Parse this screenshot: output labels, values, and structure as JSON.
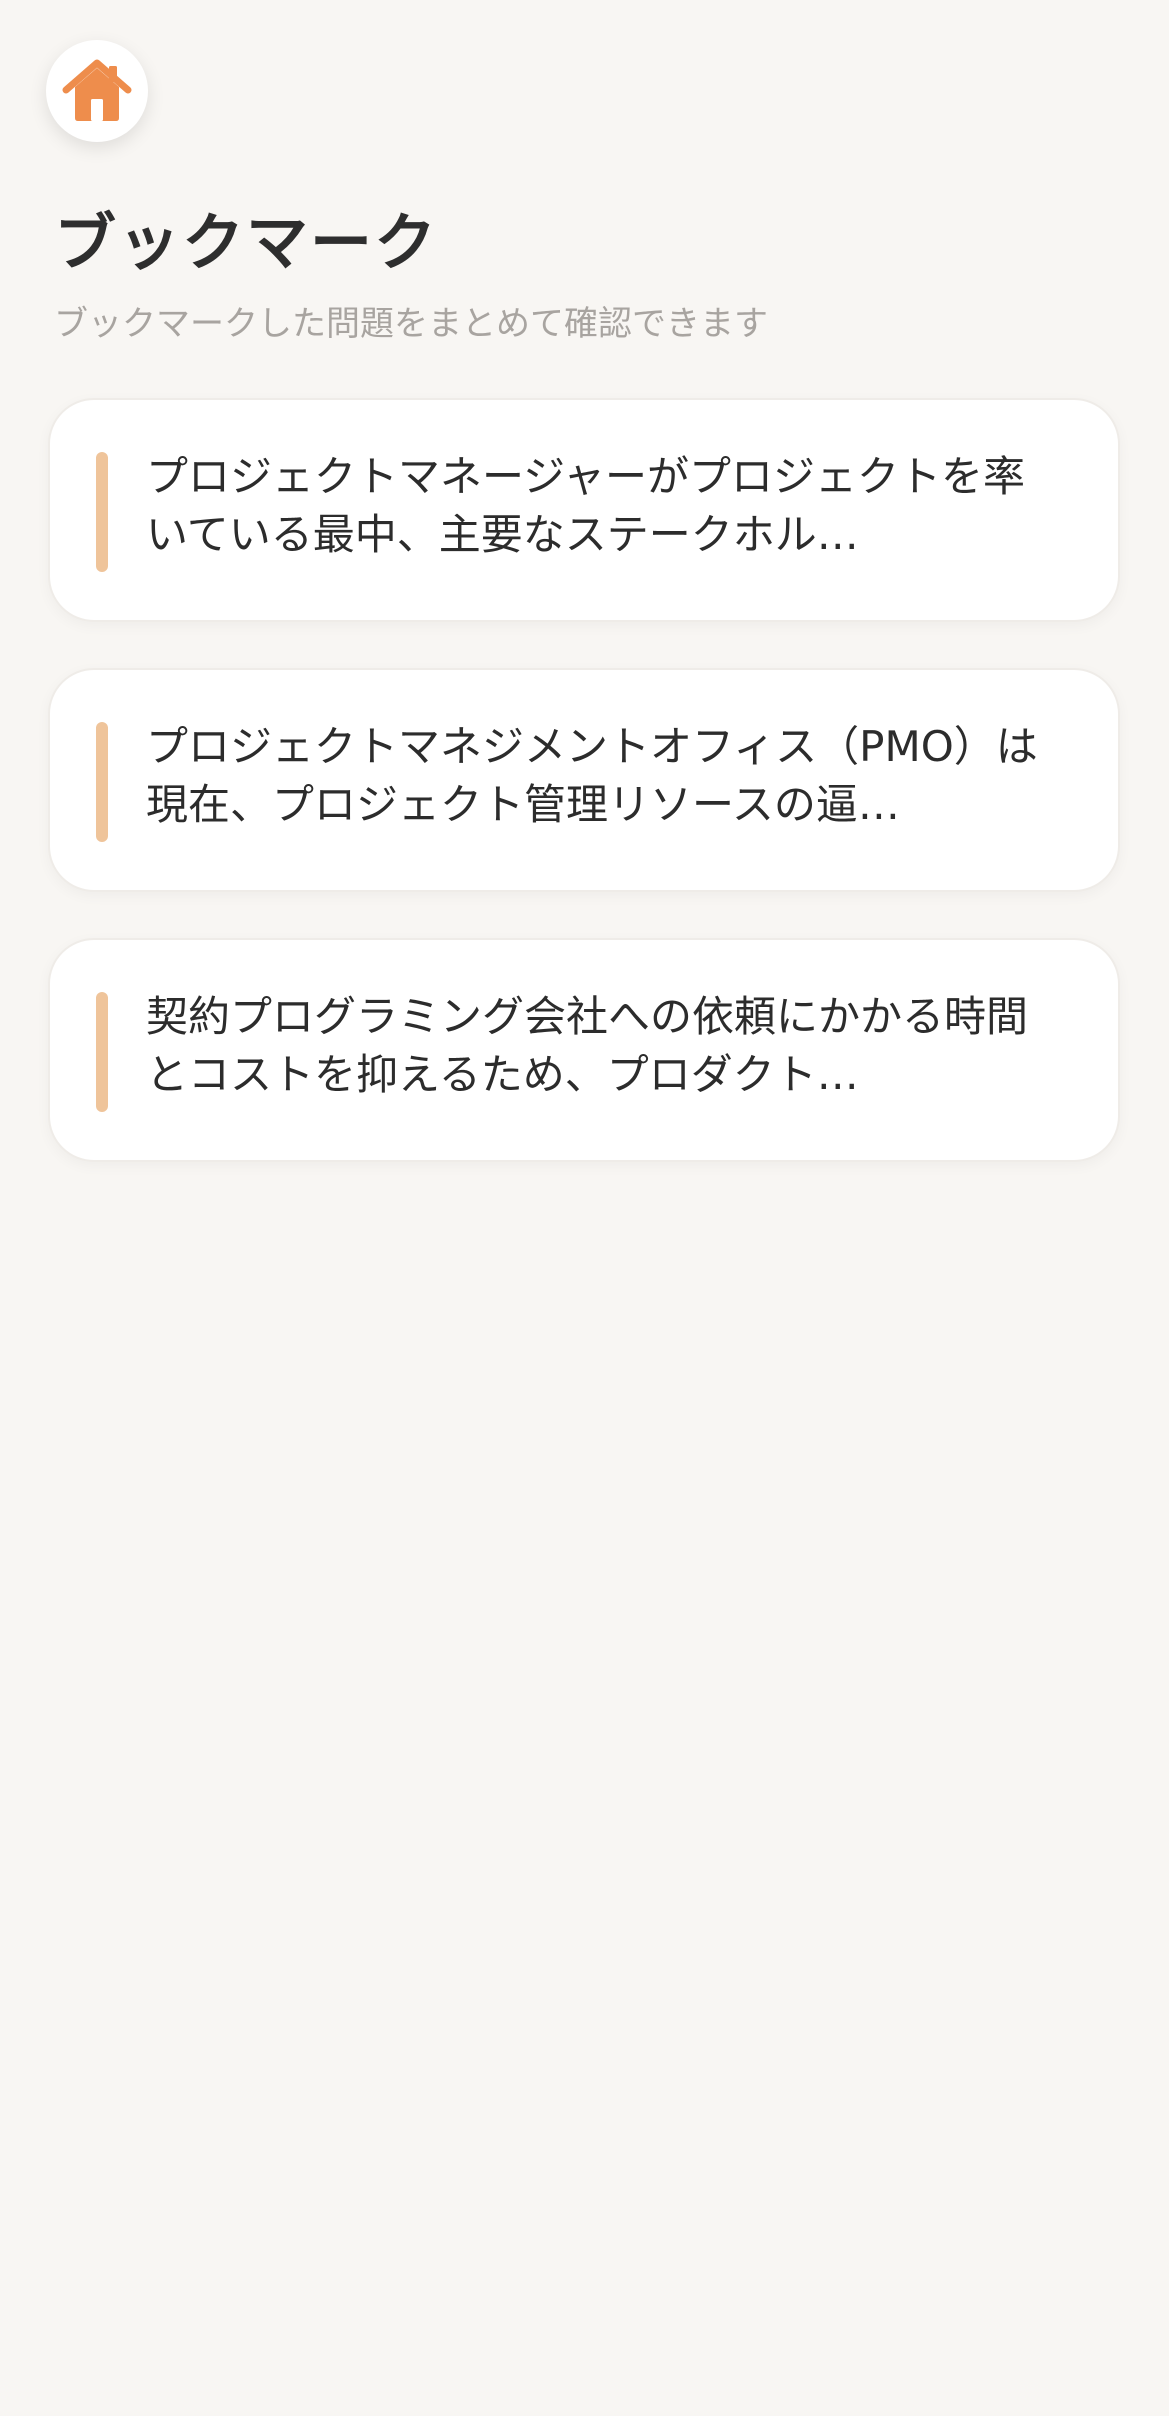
{
  "header": {
    "title": "ブックマーク",
    "subtitle": "ブックマークした問題をまとめて確認できます"
  },
  "home_button": {
    "icon": "home-icon",
    "color": "#ee8d4c"
  },
  "bookmarks": [
    {
      "text": "プロジェクトマネージャーがプロジェクトを率いている最中、主要なステークホル…"
    },
    {
      "text": "プロジェクトマネジメントオフィス（PMO）は現在、プロジェクト管理リソースの逼…"
    },
    {
      "text": "契約プログラミング会社への依頼にかかる時間とコストを抑えるため、プロダクト…"
    }
  ],
  "colors": {
    "background": "#f8f6f3",
    "accent_bar": "#efc49a",
    "title": "#2e2e2e",
    "subtitle": "#a8a4a0"
  }
}
